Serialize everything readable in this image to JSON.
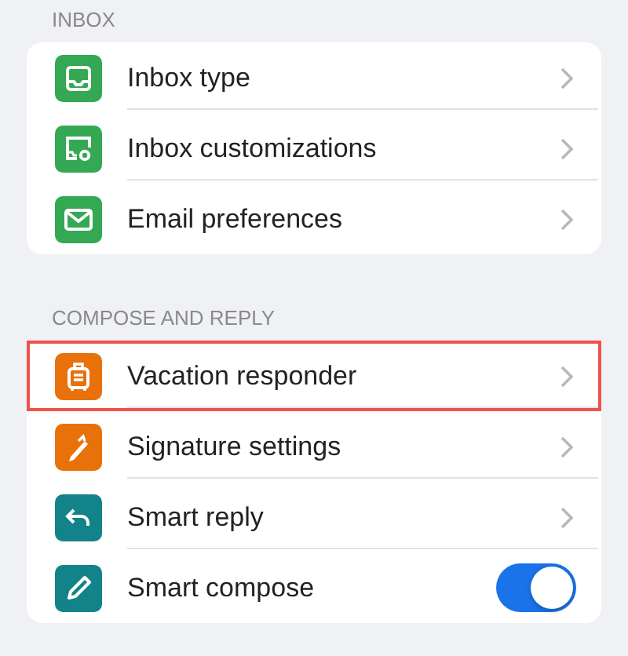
{
  "sections": [
    {
      "title": "INBOX",
      "items": [
        {
          "label": "Inbox type",
          "color": "#34a853",
          "kind": "link",
          "highlighted": false
        },
        {
          "label": "Inbox customizations",
          "color": "#34a853",
          "kind": "link",
          "highlighted": false
        },
        {
          "label": "Email preferences",
          "color": "#34a853",
          "kind": "link",
          "highlighted": false
        }
      ]
    },
    {
      "title": "COMPOSE AND REPLY",
      "items": [
        {
          "label": "Vacation responder",
          "color": "#e8710a",
          "kind": "link",
          "highlighted": true
        },
        {
          "label": "Signature settings",
          "color": "#e8710a",
          "kind": "link",
          "highlighted": false
        },
        {
          "label": "Smart reply",
          "color": "#128389",
          "kind": "link",
          "highlighted": false
        },
        {
          "label": "Smart compose",
          "color": "#128389",
          "kind": "toggle",
          "on": true,
          "highlighted": false
        }
      ]
    }
  ]
}
